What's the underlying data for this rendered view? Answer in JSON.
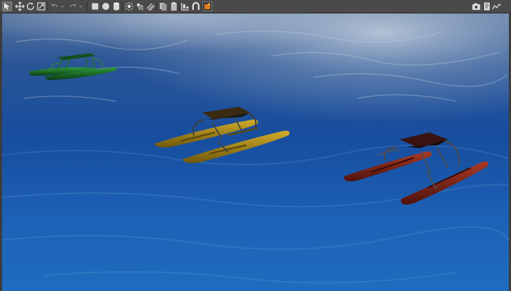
{
  "toolbar": {
    "left_tools": [
      {
        "name": "select-tool",
        "icon": "arrow-cursor-icon",
        "active": true
      },
      {
        "name": "move-tool",
        "icon": "move-arrows-icon",
        "active": false
      },
      {
        "name": "rotate-tool",
        "icon": "rotate-icon",
        "active": false
      },
      {
        "name": "scale-tool",
        "icon": "scale-box-icon",
        "active": false
      },
      {
        "name": "undo",
        "icon": "undo-icon",
        "active": false
      },
      {
        "name": "redo",
        "icon": "redo-icon",
        "active": false
      },
      {
        "name": "cube-primitive",
        "icon": "cube-icon",
        "active": false
      },
      {
        "name": "sphere-primitive",
        "icon": "sphere-icon",
        "active": false
      },
      {
        "name": "cylinder-primitive",
        "icon": "cylinder-icon",
        "active": false
      },
      {
        "name": "point-light",
        "icon": "sun-icon",
        "active": false
      },
      {
        "name": "spot-light",
        "icon": "spotlight-icon",
        "active": false
      },
      {
        "name": "directional-light",
        "icon": "directional-light-icon",
        "active": false
      },
      {
        "name": "copy",
        "icon": "copy-icon",
        "active": false
      },
      {
        "name": "paste",
        "icon": "paste-icon",
        "active": false
      },
      {
        "name": "align",
        "icon": "align-icon",
        "active": false
      },
      {
        "name": "magnet-snap",
        "icon": "magnet-icon",
        "active": false
      },
      {
        "name": "physics",
        "icon": "physics-icon",
        "active": false
      }
    ],
    "right_tools": [
      {
        "name": "screenshot",
        "icon": "camera-icon"
      },
      {
        "name": "log",
        "icon": "log-icon"
      },
      {
        "name": "plot",
        "icon": "plot-icon"
      }
    ]
  },
  "scene": {
    "environment": "ocean",
    "water_colors": {
      "deep": "#0c3a86",
      "mid": "#1f62b6",
      "highlight": "#b9c9dc"
    },
    "boats": [
      {
        "name": "green-boat",
        "hull_color": "#0f5a1b",
        "highlight": "#2b8a38"
      },
      {
        "name": "yellow-boat",
        "hull_color": "#8a7012",
        "highlight": "#c9a524"
      },
      {
        "name": "red-boat",
        "hull_color": "#6a1a12",
        "highlight": "#a33322"
      }
    ]
  }
}
